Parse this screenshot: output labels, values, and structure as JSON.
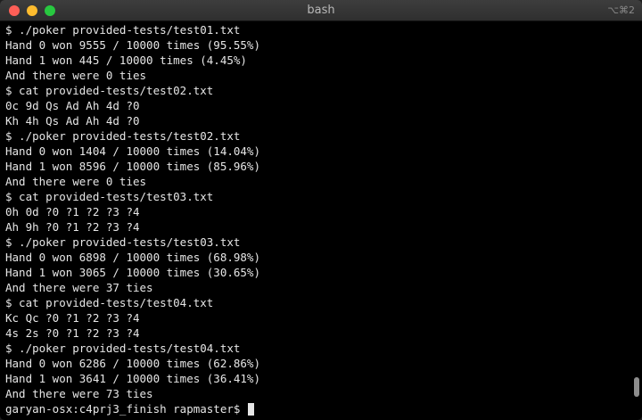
{
  "window": {
    "title": "bash",
    "shortcut": "⌥⌘2",
    "controls": [
      "close",
      "minimize",
      "zoom"
    ]
  },
  "terminal": {
    "lines": [
      "$ ./poker provided-tests/test01.txt",
      "Hand 0 won 9555 / 10000 times (95.55%)",
      "Hand 1 won 445 / 10000 times (4.45%)",
      "And there were 0 ties",
      "$ cat provided-tests/test02.txt",
      "0c 9d Qs Ad Ah 4d ?0",
      "Kh 4h Qs Ad Ah 4d ?0",
      "$ ./poker provided-tests/test02.txt",
      "Hand 0 won 1404 / 10000 times (14.04%)",
      "Hand 1 won 8596 / 10000 times (85.96%)",
      "And there were 0 ties",
      "$ cat provided-tests/test03.txt",
      "0h 0d ?0 ?1 ?2 ?3 ?4",
      "Ah 9h ?0 ?1 ?2 ?3 ?4",
      "$ ./poker provided-tests/test03.txt",
      "Hand 0 won 6898 / 10000 times (68.98%)",
      "Hand 1 won 3065 / 10000 times (30.65%)",
      "And there were 37 ties",
      "$ cat provided-tests/test04.txt",
      "Kc Qc ?0 ?1 ?2 ?3 ?4",
      "4s 2s ?0 ?1 ?2 ?3 ?4",
      "$ ./poker provided-tests/test04.txt",
      "Hand 0 won 6286 / 10000 times (62.86%)",
      "Hand 1 won 3641 / 10000 times (36.41%)",
      "And there were 73 ties"
    ],
    "prompt": "garyan-osx:c4prj3_finish rapmaster$ "
  },
  "scrollbar": {
    "position_fraction": 0.95
  },
  "colors": {
    "background": "#000000",
    "text": "#e6e6e6",
    "close": "#fe5f57",
    "minimize": "#febc2e",
    "zoom": "#28c840"
  }
}
